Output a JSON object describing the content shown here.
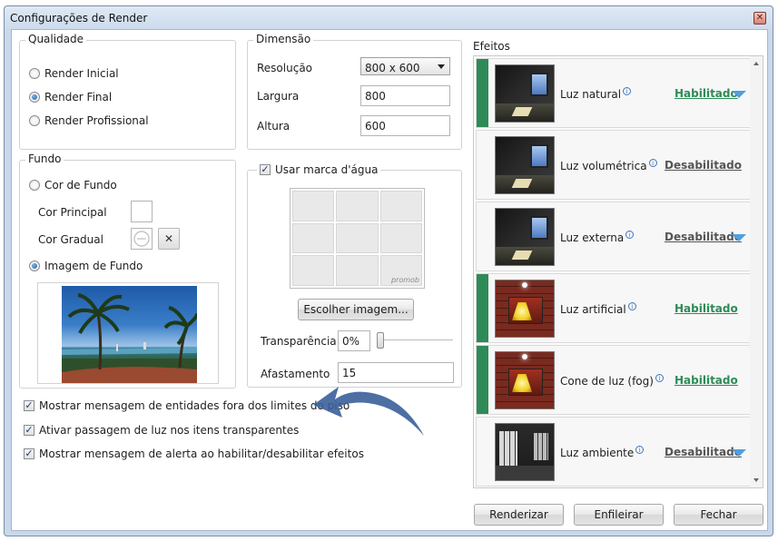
{
  "window": {
    "title": "Configurações de Render"
  },
  "qualidade": {
    "title": "Qualidade",
    "options": [
      "Render Inicial",
      "Render Final",
      "Render Profissional"
    ],
    "selected_index": 1
  },
  "dimensao": {
    "title": "Dimensão",
    "resolucao_label": "Resolução",
    "resolucao_value": "800 x 600",
    "largura_label": "Largura",
    "largura_value": "800",
    "altura_label": "Altura",
    "altura_value": "600"
  },
  "fundo": {
    "title": "Fundo",
    "cor_de_fundo": "Cor de Fundo",
    "cor_principal": "Cor Principal",
    "cor_gradual": "Cor Gradual",
    "clear_symbol": "✕",
    "imagem_de_fundo": "Imagem de Fundo",
    "selected": "Imagem de Fundo"
  },
  "marca": {
    "title": "Usar marca d'água",
    "checked": true,
    "brand_text": "promob",
    "choose_button": "Escolher imagem...",
    "transparencia_label": "Transparência",
    "transparencia_value": "0%",
    "transparencia_level": 0,
    "afastamento_label": "Afastamento",
    "afastamento_value": "15"
  },
  "options": {
    "mostrar_mensagem_entidades": "Mostrar mensagem de entidades fora dos limites do piso",
    "ativar_passagem_luz": "Ativar passagem de luz nos itens transparentes",
    "mostrar_alerta": "Mostrar mensagem de alerta ao habilitar/desabilitar efeitos"
  },
  "efeitos": {
    "title": "Efeitos",
    "items": [
      {
        "name": "Luz natural",
        "status": "Habilitado",
        "enabled": true,
        "has_menu": true,
        "icon": "room-thumbnail"
      },
      {
        "name": "Luz volumétrica",
        "status": "Desabilitado",
        "enabled": false,
        "has_menu": false,
        "icon": "room-thumbnail"
      },
      {
        "name": "Luz externa",
        "status": "Desabilitado",
        "enabled": false,
        "has_menu": true,
        "icon": "room-thumbnail"
      },
      {
        "name": "Luz artificial",
        "status": "Habilitado",
        "enabled": true,
        "has_menu": false,
        "icon": "brick-light-thumbnail"
      },
      {
        "name": "Cone de luz (fog)",
        "status": "Habilitado",
        "enabled": true,
        "has_menu": false,
        "icon": "brick-light-thumbnail"
      },
      {
        "name": "Luz ambiente",
        "status": "Desabilitado",
        "enabled": false,
        "has_menu": true,
        "icon": "hall-thumbnail"
      }
    ]
  },
  "buttons": {
    "renderizar": "Renderizar",
    "enfileirar": "Enfileirar",
    "fechar": "Fechar"
  },
  "colors": {
    "enabled": "#2e8b57",
    "disabled_text": "#555555",
    "menu_arrow": "#4ea0e0",
    "annotation_arrow": "#3a5f9a"
  }
}
